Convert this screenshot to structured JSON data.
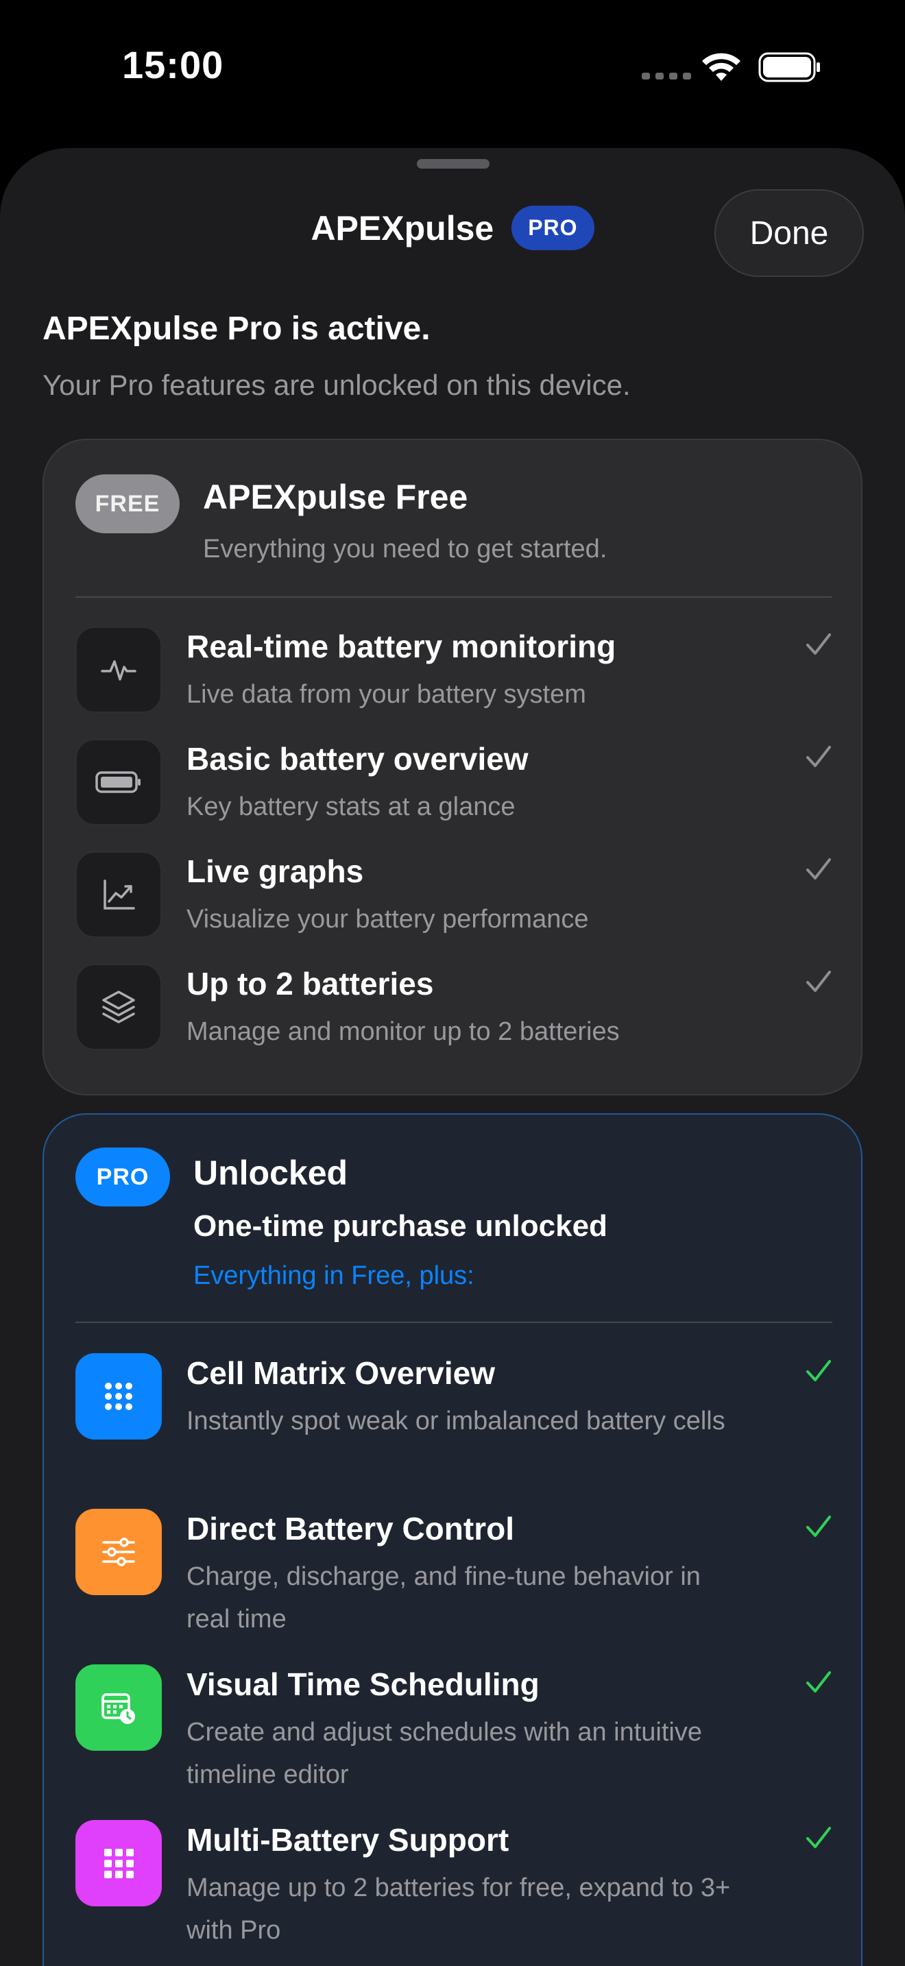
{
  "status_bar": {
    "time": "15:00"
  },
  "sheet": {
    "title": "APEXpulse",
    "title_badge": "PRO",
    "done_label": "Done",
    "active_title": "APEXpulse Pro is active.",
    "active_subtitle": "Your Pro features are unlocked on this device."
  },
  "free_card": {
    "badge": "FREE",
    "name": "APEXpulse Free",
    "description": "Everything you need to get started.",
    "features": [
      {
        "icon": "waveform-icon",
        "title": "Real-time battery monitoring",
        "desc": "Live data from your battery system"
      },
      {
        "icon": "battery-icon",
        "title": "Basic battery overview",
        "desc": "Key battery stats at a glance"
      },
      {
        "icon": "chart-icon",
        "title": "Live graphs",
        "desc": "Visualize your battery performance"
      },
      {
        "icon": "layers-icon",
        "title": "Up to 2 batteries",
        "desc": "Manage and monitor up to 2 batteries"
      }
    ]
  },
  "pro_card": {
    "badge": "PRO",
    "name": "Unlocked",
    "line2": "One-time purchase unlocked",
    "line3": "Everything in Free, plus:",
    "features": [
      {
        "icon": "grid-icon",
        "color": "#0a84ff",
        "title": "Cell Matrix Overview",
        "desc": "Instantly spot weak or imbalanced battery cells"
      },
      {
        "icon": "sliders-icon",
        "color": "#ff9230",
        "title": "Direct Battery Control",
        "desc": "Charge, discharge, and fine-tune behavior in real time"
      },
      {
        "icon": "calendar-clock-icon",
        "color": "#30d158",
        "title": "Visual Time Scheduling",
        "desc": "Create and adjust schedules with an intuitive timeline editor"
      },
      {
        "icon": "grid-icon",
        "color": "#e040fb",
        "title": "Multi-Battery Support",
        "desc": "Manage up to 2 batteries for free, expand to 3+ with Pro"
      }
    ]
  }
}
